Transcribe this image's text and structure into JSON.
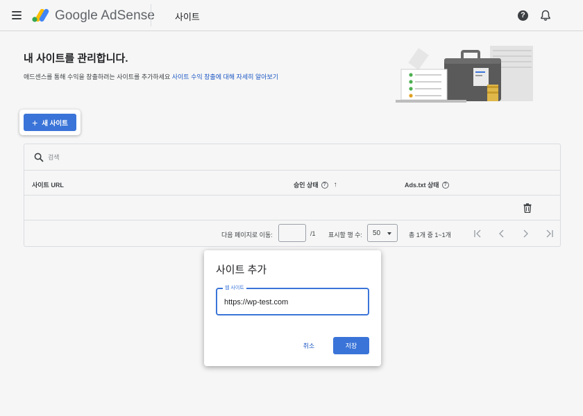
{
  "header": {
    "brand": "Google AdSense",
    "page": "사이트",
    "help_glyph": "?"
  },
  "intro": {
    "title": "내 사이트를 관리합니다.",
    "description": "애드센스를 통해 수익을 창출하려는 사이트를 추가하세요",
    "link": "사이트 수익 창출에 대해 자세히 알아보기"
  },
  "new_site": {
    "icon": "+",
    "label": "새 사이트"
  },
  "table": {
    "search_placeholder": "검색",
    "columns": {
      "url": "사이트 URL",
      "status": "승인 상태",
      "ads_txt": "Ads.txt 상태"
    },
    "sort_glyph": "↑",
    "help_glyph": "?",
    "rows": [
      {
        "url": "",
        "status": "",
        "ads_txt": ""
      }
    ],
    "footer": {
      "goto_label": "다음 페이지로 이동:",
      "goto_value": "",
      "goto_total": "/1",
      "rows_label": "표시할 행 수:",
      "rows_value": "50",
      "count": "총 1개 중 1~1개"
    }
  },
  "dialog": {
    "title": "사이트 추가",
    "field_label": "웹 사이트",
    "field_value": "https://wp-test.com",
    "cancel": "취소",
    "save": "저장"
  },
  "colors": {
    "primary": "#3a74d8",
    "link": "#1a56c4",
    "background": "#f6f6f6"
  },
  "icons": [
    "menu-icon",
    "adsense-logo-icon",
    "help-icon",
    "bell-icon",
    "plus-icon",
    "search-icon",
    "help-circle-icon",
    "sort-up-icon",
    "trash-icon",
    "chevron-down-icon",
    "first-page-icon",
    "prev-page-icon",
    "next-page-icon",
    "last-page-icon"
  ]
}
